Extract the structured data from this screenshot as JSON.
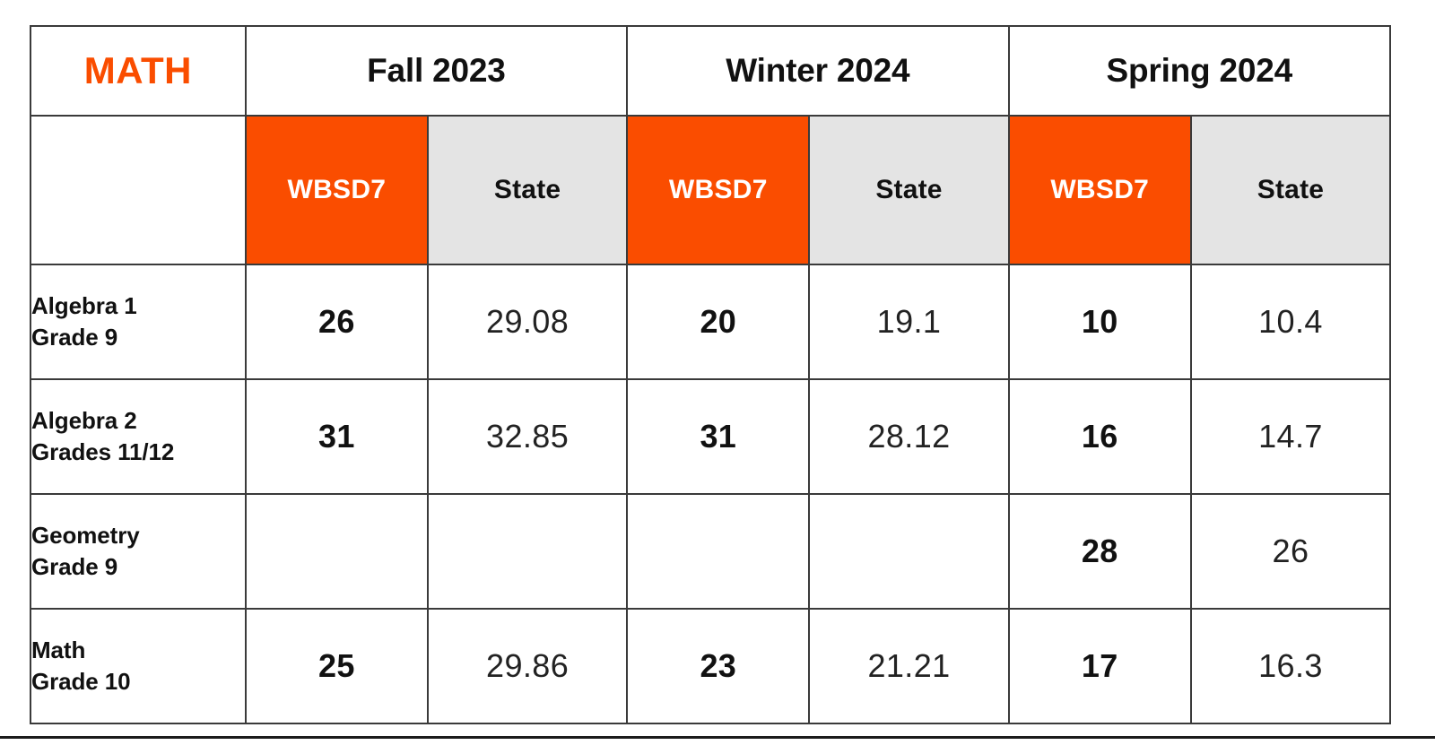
{
  "table": {
    "subject": "MATH",
    "terms": [
      "Fall 2023",
      "Winter 2024",
      "Spring 2024"
    ],
    "source_headers": [
      "WBSD7",
      "State"
    ],
    "colors": {
      "district_accent": "#FA4D00",
      "state_background": "#E4E4E4",
      "border": "#3A3A3A",
      "text": "#111111"
    },
    "rows": [
      {
        "label_line1": "Algebra 1",
        "label_line2": "Grade 9",
        "fall_wbsd7": "26",
        "fall_state": "29.08",
        "winter_wbsd7": "20",
        "winter_state": "19.1",
        "spring_wbsd7": "10",
        "spring_state": "10.4"
      },
      {
        "label_line1": "Algebra 2",
        "label_line2": "Grades 11/12",
        "fall_wbsd7": "31",
        "fall_state": "32.85",
        "winter_wbsd7": "31",
        "winter_state": "28.12",
        "spring_wbsd7": "16",
        "spring_state": "14.7"
      },
      {
        "label_line1": "Geometry",
        "label_line2": "Grade 9",
        "fall_wbsd7": "",
        "fall_state": "",
        "winter_wbsd7": "",
        "winter_state": "",
        "spring_wbsd7": "28",
        "spring_state": "26"
      },
      {
        "label_line1": "Math",
        "label_line2": "Grade 10",
        "fall_wbsd7": "25",
        "fall_state": "29.86",
        "winter_wbsd7": "23",
        "winter_state": "21.21",
        "spring_wbsd7": "17",
        "spring_state": "16.3"
      }
    ]
  }
}
